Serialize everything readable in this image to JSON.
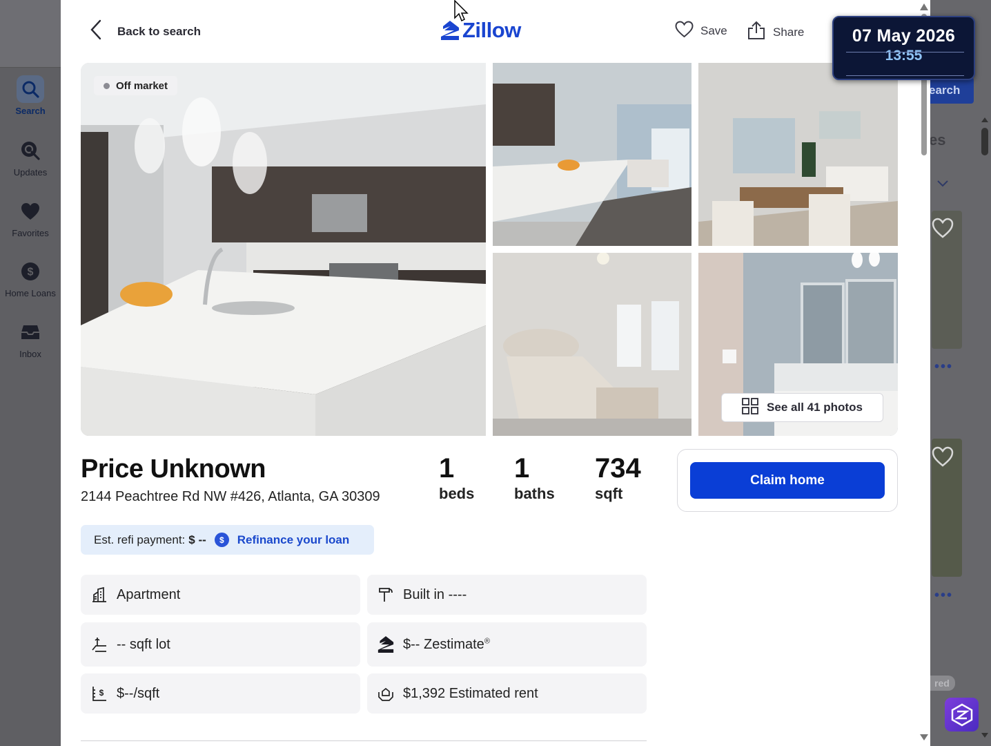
{
  "sidebar": {
    "items": [
      {
        "label": "Search",
        "icon": "search-icon"
      },
      {
        "label": "Updates",
        "icon": "updates-icon"
      },
      {
        "label": "Favorites",
        "icon": "heart-icon"
      },
      {
        "label": "Home Loans",
        "icon": "dollar-icon"
      },
      {
        "label": "Inbox",
        "icon": "inbox-icon"
      }
    ]
  },
  "background": {
    "search_button_label": "earch",
    "partial_heading": "es",
    "partial_badge": "red"
  },
  "header": {
    "back_label": "Back to search",
    "logo_text": "Zillow",
    "save_label": "Save",
    "share_label": "Share"
  },
  "photos": {
    "status_badge": "Off market",
    "see_all_label": "See all 41 photos"
  },
  "listing": {
    "price": "Price Unknown",
    "address": "2144 Peachtree Rd NW #426, Atlanta, GA 30309",
    "beds_value": "1",
    "beds_label": "beds",
    "baths_value": "1",
    "baths_label": "baths",
    "sqft_value": "734",
    "sqft_label": "sqft",
    "claim_label": "Claim home"
  },
  "refi": {
    "label": "Est. refi payment:",
    "value": "$ --",
    "link_label": "Refinance your loan"
  },
  "facts": {
    "type": "Apartment",
    "built": "Built in ----",
    "lot": "-- sqft lot",
    "zestimate": "$-- Zestimate",
    "zestimate_mark": "®",
    "price_per_sqft": "$--/sqft",
    "rent": "$1,392 Estimated rent"
  },
  "datetime": {
    "date": "07 May 2026",
    "time": "13:55"
  },
  "colors": {
    "brand_blue": "#0a3ed6",
    "refi_bg": "#e4eefb",
    "date_bg": "#0c1636"
  }
}
